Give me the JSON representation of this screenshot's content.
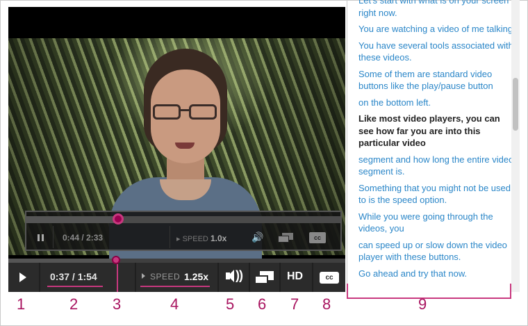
{
  "inner_controls": {
    "time": "0:44 / 2:33",
    "speed_label": "SPEED",
    "speed_value": "1.0x",
    "cc_label": "cc"
  },
  "controls": {
    "time": "0:37 / 1:54",
    "speed_label": "SPEED",
    "speed_value": "1.25x",
    "hd_label": "HD",
    "cc_label": "cc",
    "progress_fraction": 0.32
  },
  "transcript": {
    "lines": [
      {
        "text": "Let's start with what is on your screen right now.",
        "active": false
      },
      {
        "text": "You are watching a video of me talking.",
        "active": false
      },
      {
        "text": "You have several tools associated with these videos.",
        "active": false
      },
      {
        "text": "Some of them are standard video buttons like the play/pause button",
        "active": false
      },
      {
        "text": "on the bottom left.",
        "active": false
      },
      {
        "text": "Like most video players, you can see how far you are into this particular video",
        "active": true
      },
      {
        "text": "segment and how long the entire video segment is.",
        "active": false
      },
      {
        "text": "Something that you might not be used to is the speed option.",
        "active": false
      },
      {
        "text": "While you were going through the videos, you",
        "active": false
      },
      {
        "text": "can speed up or slow down the video player with these buttons.",
        "active": false
      },
      {
        "text": "Go ahead and try that now.",
        "active": false
      }
    ]
  },
  "callouts": [
    "1",
    "2",
    "3",
    "4",
    "5",
    "6",
    "7",
    "8",
    "9"
  ],
  "colors": {
    "accent": "#c8387f",
    "link": "#2a86c8",
    "bar": "#2b2b2b"
  }
}
